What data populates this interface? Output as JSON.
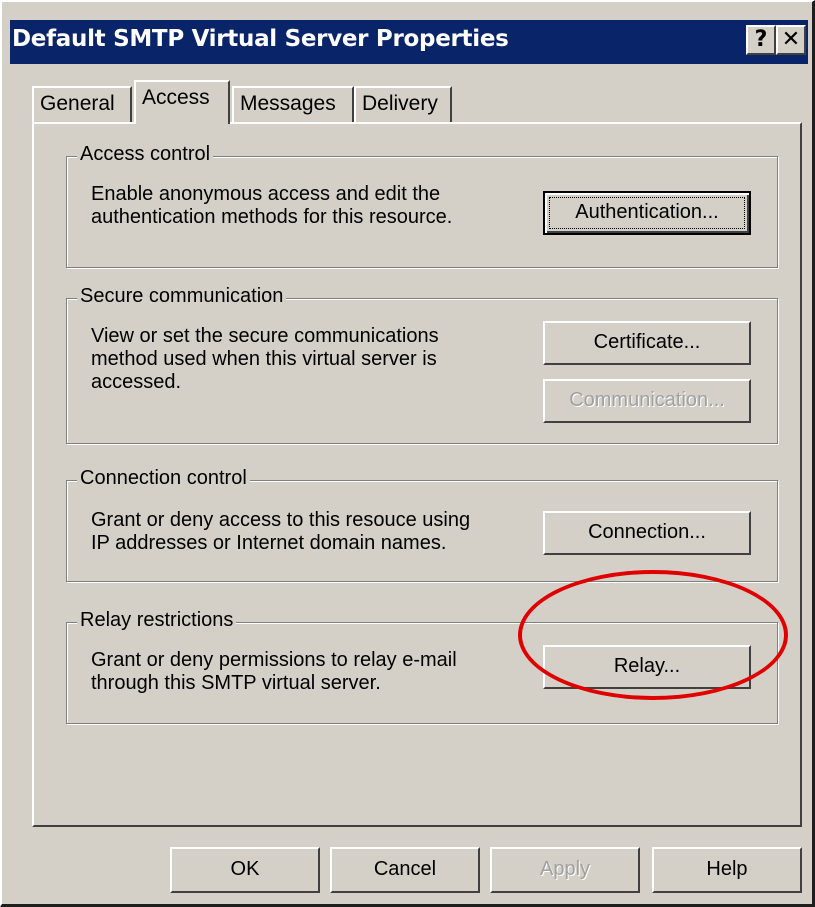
{
  "window": {
    "title": "Default SMTP Virtual Server Properties",
    "help_button": "?",
    "close_button": "✕"
  },
  "tabs": [
    {
      "label": "General"
    },
    {
      "label": "Access"
    },
    {
      "label": "Messages"
    },
    {
      "label": "Delivery"
    }
  ],
  "access_control": {
    "legend": "Access control",
    "description": "Enable anonymous access and edit the\nauthentication methods for this resource.",
    "button": "Authentication..."
  },
  "secure_communication": {
    "legend": "Secure communication",
    "description": "View or set the secure communications\nmethod used when this virtual server is\naccessed.",
    "certificate_button": "Certificate...",
    "communication_button": "Communication..."
  },
  "connection_control": {
    "legend": "Connection control",
    "description": "Grant or deny access to this resouce using\nIP addresses or Internet domain names.",
    "button": "Connection..."
  },
  "relay_restrictions": {
    "legend": "Relay restrictions",
    "description": "Grant or deny permissions to relay e-mail\nthrough this SMTP virtual server.",
    "button": "Relay..."
  },
  "footer": {
    "ok": "OK",
    "cancel": "Cancel",
    "apply": "Apply",
    "help": "Help"
  },
  "colors": {
    "titlebar": "#0a246a",
    "dialog_face": "#d4d0c8",
    "annotation_circle": "#e00000"
  }
}
